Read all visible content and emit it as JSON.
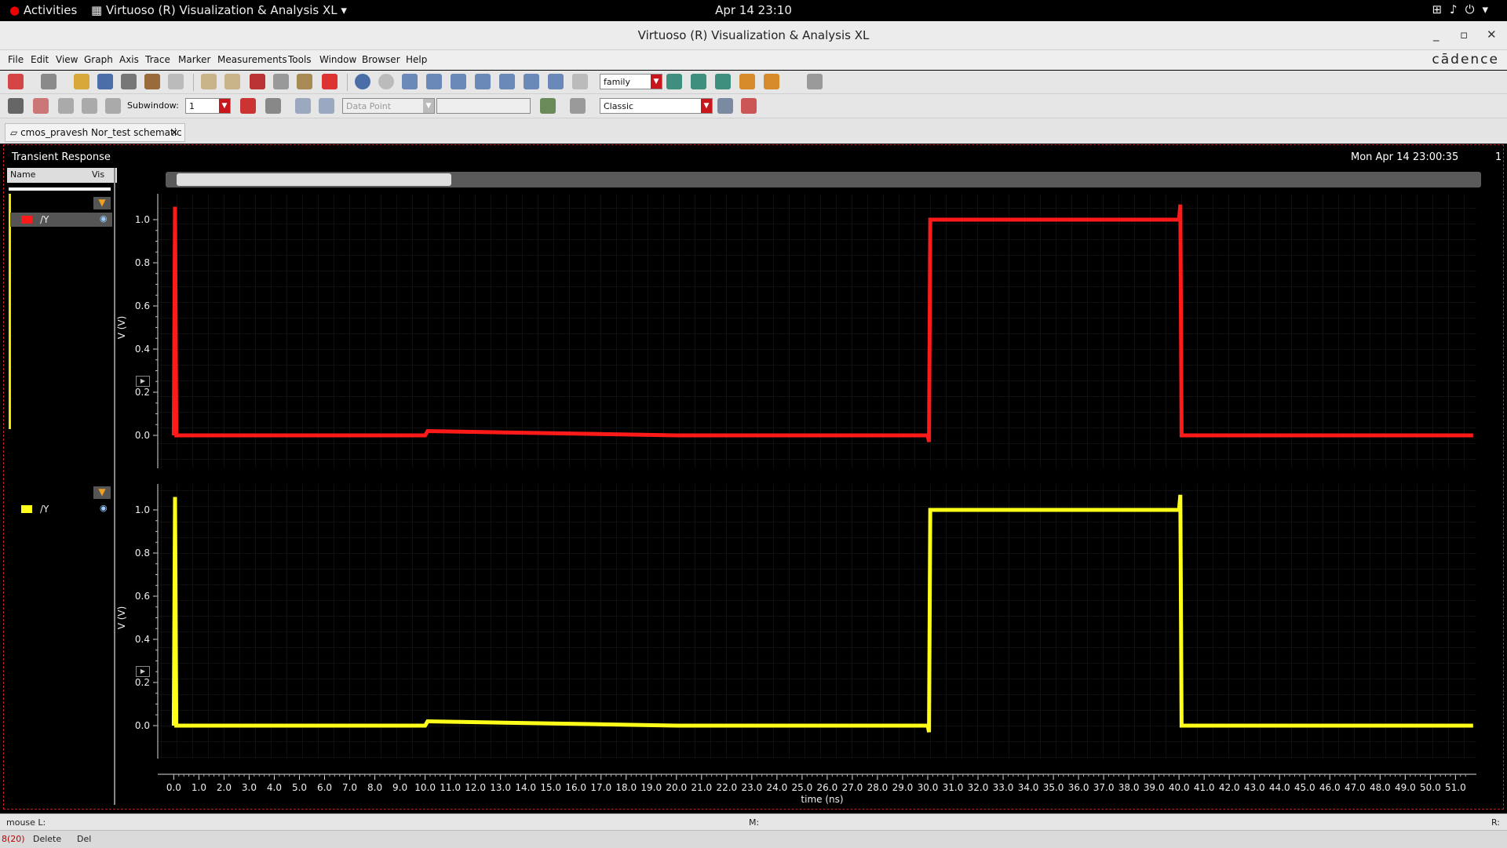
{
  "topbar": {
    "activities": "Activities",
    "app_name": "Virtuoso (R) Visualization & Analysis XL",
    "clock": "Apr 14  23:10"
  },
  "window": {
    "title": "Virtuoso (R) Visualization & Analysis XL"
  },
  "menubar": {
    "items": [
      "File",
      "Edit",
      "View",
      "Graph",
      "Axis",
      "Trace",
      "Marker",
      "Measurements",
      "Tools",
      "Window",
      "Browser",
      "Help"
    ],
    "brand": "cādence"
  },
  "toolbar1": {
    "family_combo": "family"
  },
  "toolbar2": {
    "subwindow_label": "Subwindow:",
    "subwindow_value": "1",
    "datapoint_placeholder": "Data Point",
    "classic_combo": "Classic"
  },
  "tab": {
    "label": "cmos_pravesh Nor_test schematic"
  },
  "panel": {
    "title": "Transient Response",
    "timestamp": "Mon Apr 14 23:00:35",
    "subwindow_number": "1",
    "name_col": "Name",
    "vis_col": "Vis"
  },
  "traces": [
    {
      "name": "/Y",
      "color": "#ff1a1a"
    },
    {
      "name": "/Y",
      "color": "#ffff1a"
    }
  ],
  "chart_data": [
    {
      "type": "line",
      "ylabel": "V (V)",
      "xlabel": "time (ns)",
      "ylim": [
        0.0,
        1.0
      ],
      "yticks": [
        "0.0",
        "0.2",
        "0.4",
        "0.6",
        "0.8",
        "1.0"
      ],
      "series": [
        {
          "name": "/Y",
          "color": "#ff1a1a",
          "x": [
            0.0,
            0.05,
            0.1,
            10.0,
            10.1,
            20.0,
            30.0,
            30.05,
            30.1,
            40.0,
            40.05,
            40.1,
            50.0,
            51.7
          ],
          "y": [
            0.0,
            1.06,
            0.0,
            0.0,
            0.02,
            0.0,
            0.0,
            -0.03,
            1.0,
            1.0,
            1.07,
            0.0,
            0.0,
            0.0
          ]
        }
      ]
    },
    {
      "type": "line",
      "ylabel": "V (V)",
      "xlabel": "time (ns)",
      "ylim": [
        0.0,
        1.0
      ],
      "yticks": [
        "0.0",
        "0.2",
        "0.4",
        "0.6",
        "0.8",
        "1.0"
      ],
      "series": [
        {
          "name": "/Y",
          "color": "#ffff1a",
          "x": [
            0.0,
            0.05,
            0.1,
            10.0,
            10.1,
            20.0,
            30.0,
            30.05,
            30.1,
            40.0,
            40.05,
            40.1,
            50.0,
            51.7
          ],
          "y": [
            0.0,
            1.06,
            0.0,
            0.0,
            0.02,
            0.0,
            0.0,
            -0.03,
            1.0,
            1.0,
            1.07,
            0.0,
            0.0,
            0.0
          ]
        }
      ]
    }
  ],
  "xaxis": {
    "label": "time (ns)",
    "ticks": [
      "0.0",
      "1.0",
      "2.0",
      "3.0",
      "4.0",
      "5.0",
      "6.0",
      "7.0",
      "8.0",
      "9.0",
      "10.0",
      "11.0",
      "12.0",
      "13.0",
      "14.0",
      "15.0",
      "16.0",
      "17.0",
      "18.0",
      "19.0",
      "20.0",
      "21.0",
      "22.0",
      "23.0",
      "24.0",
      "25.0",
      "26.0",
      "27.0",
      "28.0",
      "29.0",
      "30.0",
      "31.0",
      "32.0",
      "33.0",
      "34.0",
      "35.0",
      "36.0",
      "37.0",
      "38.0",
      "39.0",
      "40.0",
      "41.0",
      "42.0",
      "43.0",
      "44.0",
      "45.0",
      "46.0",
      "47.0",
      "48.0",
      "49.0",
      "50.0",
      "51.0"
    ]
  },
  "status": {
    "mouse": "mouse L:",
    "middle": "M:",
    "right": "R:",
    "count": "8(20)",
    "delete": "Delete",
    "del": "Del"
  }
}
